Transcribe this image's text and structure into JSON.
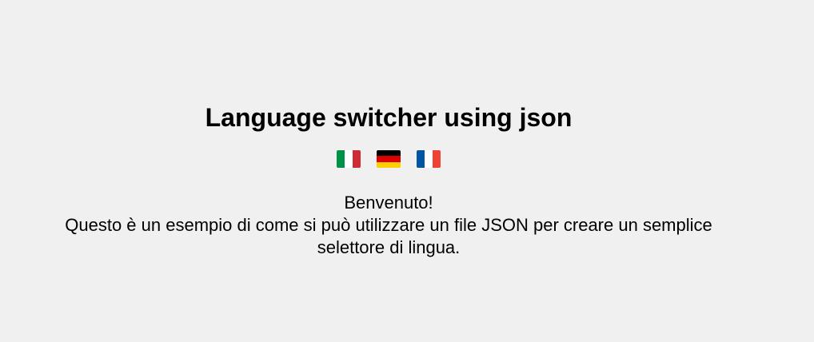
{
  "header": {
    "title": "Language switcher using json"
  },
  "flags": [
    {
      "name": "italy-flag",
      "colors": [
        "#009246",
        "#ffffff",
        "#ce2b37"
      ]
    },
    {
      "name": "germany-flag",
      "colors": [
        "#000000",
        "#dd0000",
        "#ffce00"
      ]
    },
    {
      "name": "france-flag",
      "colors": [
        "#0055a4",
        "#ffffff",
        "#ef4135"
      ]
    }
  ],
  "content": {
    "greeting": "Benvenuto!",
    "description": "Questo è un esempio di come si può utilizzare un file JSON per creare un semplice selettore di lingua."
  },
  "colors": {
    "background": "#f0f0f0",
    "text": "#000000"
  }
}
